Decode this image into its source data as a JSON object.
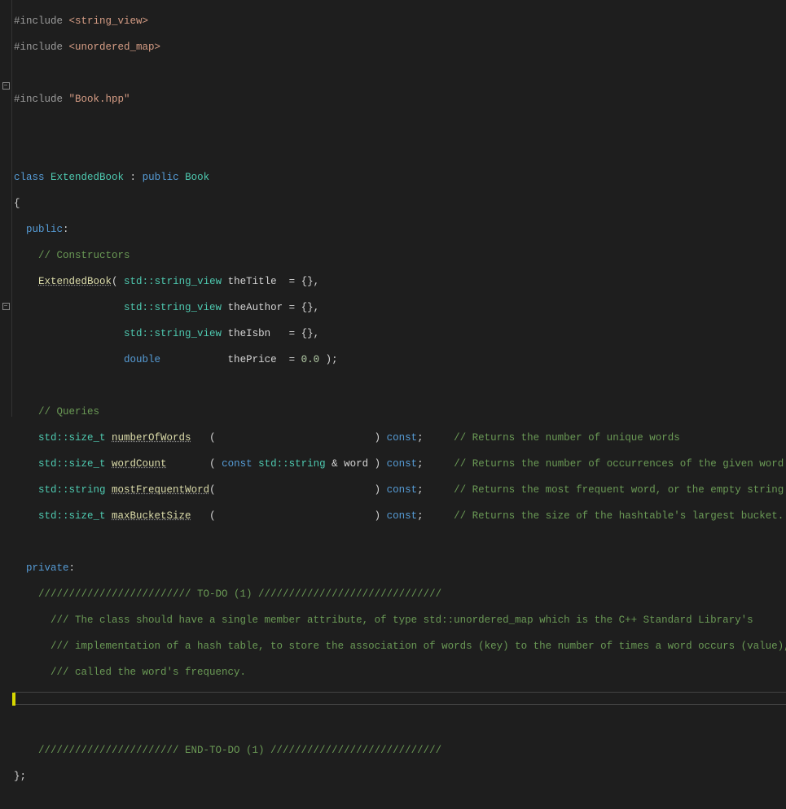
{
  "lines": {
    "l1a": "#include ",
    "l1b": "<string_view>",
    "l2a": "#include ",
    "l2b": "<unordered_map>",
    "l4a": "#include ",
    "l4b": "\"Book.hpp\"",
    "l7_class": "class",
    "l7_name": " ExtendedBook ",
    "l7_colon": ": ",
    "l7_pub": "public",
    "l7_book": " Book",
    "l8": "{",
    "l9_pub": "  public",
    "l9_colon": ":",
    "l10": "    // Constructors",
    "l11_a": "    ",
    "l11_fn": "ExtendedBook",
    "l11_b": "( ",
    "l11_std": "std",
    "l11_sv": "::string_view",
    "l11_p": " theTitle  = {},",
    "l12_sp": "                  ",
    "l12_std": "std",
    "l12_sv": "::string_view",
    "l12_p": " theAuthor = {},",
    "l13_sp": "                  ",
    "l13_std": "std",
    "l13_sv": "::string_view",
    "l13_p": " theIsbn   = {},",
    "l14_sp": "                  ",
    "l14_dbl": "double",
    "l14_mid": "           thePrice  = ",
    "l14_num": "0.0",
    "l14_end": " );",
    "l16": "    // Queries",
    "l17_a": "    ",
    "l17_std": "std",
    "l17_size": "::size_t ",
    "l17_fn": "numberOfWords",
    "l17_mid": "   (                          ) ",
    "l17_const": "const",
    "l17_semi": ";     ",
    "l17_cm": "// Returns the number of unique words",
    "l18_a": "    ",
    "l18_std": "std",
    "l18_size": "::size_t ",
    "l18_fn": "wordCount",
    "l18_mid1": "       ( ",
    "l18_const1": "const",
    "l18_mid2": " ",
    "l18_std2": "std",
    "l18_string": "::string ",
    "l18_word": "& word ) ",
    "l18_const2": "const",
    "l18_semi": ";     ",
    "l18_cm": "// Returns the number of occurrences of the given word",
    "l19_a": "    ",
    "l19_std": "std",
    "l19_string": "::string ",
    "l19_fn": "mostFrequentWord",
    "l19_mid": "(                          ) ",
    "l19_const": "const",
    "l19_semi": ";     ",
    "l19_cm": "// Returns the most frequent word, or the empty string if the B",
    "l20_a": "    ",
    "l20_std": "std",
    "l20_size": "::size_t ",
    "l20_fn": "maxBucketSize",
    "l20_mid": "   (                          ) ",
    "l20_const": "const",
    "l20_semi": ";     ",
    "l20_cm": "// Returns the size of the hashtable's largest bucket. See the ",
    "l22_priv": "  private",
    "l22_colon": ":",
    "l23": "    ///////////////////////// TO-DO (1) //////////////////////////////",
    "l24": "      /// The class should have a single member attribute, of type std::unordered_map which is the C++ Standard Library's",
    "l25": "      /// implementation of a hash table, to store the association of words (key) to the number of times a word occurs (value), also",
    "l26": "      /// called the word's frequency.",
    "l29": "    /////////////////////// END-TO-DO (1) ////////////////////////////",
    "l30": "};"
  },
  "gutter": {
    "minus": "−"
  }
}
